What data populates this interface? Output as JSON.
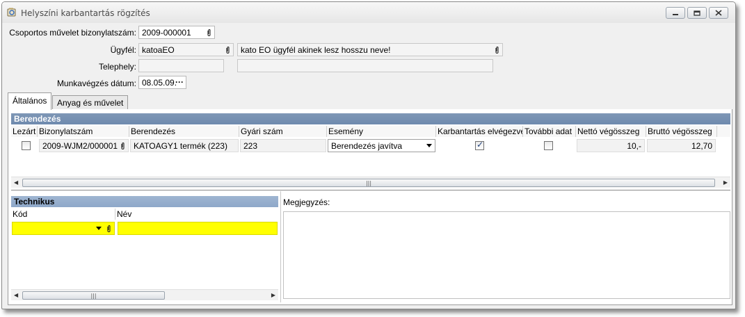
{
  "window": {
    "title": "Helyszíni karbantartás rögzítés",
    "controls": [
      "minimize",
      "maximize",
      "close"
    ]
  },
  "header": {
    "bizonylatszam_label": "Csoportos művelet bizonylatszám:",
    "bizonylatszam_value": "2009-000001",
    "ugyfel_label": "Ügyfél:",
    "ugyfel_code": "katoaEO",
    "ugyfel_name": "kato EO ügyfél akinek lesz hosszu neve!",
    "telephely_label": "Telephely:",
    "telephely_code": "",
    "telephely_name": "",
    "datum_label": "Munkavégzés dátum:",
    "datum_value": "08.05.09.",
    "datum_button": "···"
  },
  "tabs": [
    {
      "label": "Általános",
      "active": true
    },
    {
      "label": "Anyag és művelet",
      "active": false
    }
  ],
  "berendezes": {
    "title": "Berendezés",
    "columns": [
      "Lezárt",
      "Bizonylatszám",
      "Berendezés",
      "Gyári szám",
      "Esemény",
      "Karbantartás elvégezve",
      "További adat",
      "Nettó végösszeg",
      "Bruttó végösszeg"
    ],
    "rows": [
      {
        "lezart": false,
        "bizonylatszam": "2009-WJM2/000001",
        "berendezes": "KATOAGY1 termék (223)",
        "gyari_szam": "223",
        "esemeny": "Berendezés javítva",
        "karbantartas_elvegezve": true,
        "tovabbi_adat": false,
        "netto": "10,-",
        "brutto": "12,70"
      }
    ]
  },
  "technikus": {
    "title": "Technikus",
    "columns": [
      "Kód",
      "Név"
    ],
    "rows": [
      {
        "kod": "",
        "nev": ""
      }
    ]
  },
  "megjegyzes": {
    "label": "Megjegyzés:",
    "value": ""
  },
  "colors": {
    "group_header": "#7f97b6",
    "technikus_header": "#9fb5d1",
    "required_field": "#ffff00"
  }
}
